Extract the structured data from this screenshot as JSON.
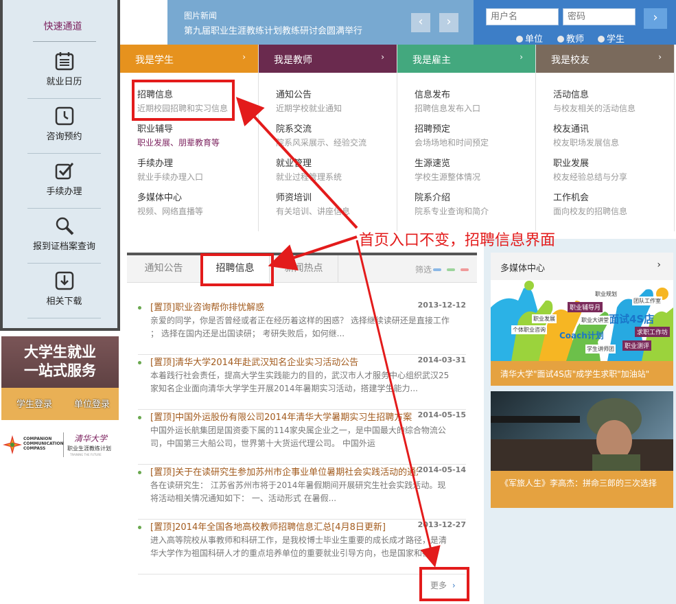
{
  "sidebar": {
    "title": "快速通道",
    "items": [
      {
        "label": "就业日历",
        "icon": "calendar-icon"
      },
      {
        "label": "咨询预约",
        "icon": "clock-icon"
      },
      {
        "label": "手续办理",
        "icon": "checkbox-icon"
      },
      {
        "label": "报到证档案查询",
        "icon": "magnifier-icon"
      },
      {
        "label": "相关下载",
        "icon": "download-icon"
      }
    ]
  },
  "promo": {
    "title_line1": "大学生就业",
    "title_line2": "一站式服务",
    "student_login": "学生登录",
    "employer_login": "单位登录"
  },
  "logos": {
    "ccc_line1": "COMPANION",
    "ccc_line2": "COMMUNICATION",
    "ccc_line3": "COMPASS",
    "tsinghua": "清华大学",
    "program": "职业生涯教练计划",
    "program_en": "TRAINING THE FUTURE"
  },
  "top_news": {
    "label": "图片新闻",
    "text": "第九届职业生涯教练计划教练研讨会圆满举行",
    "prev": "‹",
    "next": "›"
  },
  "login": {
    "username_placeholder": "用户名",
    "password_placeholder": "密码",
    "go": "›",
    "roles": [
      "单位",
      "教师",
      "学生"
    ]
  },
  "menu": {
    "columns": [
      {
        "head": "我是学生",
        "color": "#e6921e",
        "entries": [
          {
            "title": "招聘信息",
            "desc": "近期校园招聘和实习信息"
          },
          {
            "title": "职业辅导",
            "desc": "职业发展、朋辈教育等"
          },
          {
            "title": "手续办理",
            "desc": "就业手续办理入口"
          },
          {
            "title": "多媒体中心",
            "desc": "视频、网络直播等"
          }
        ]
      },
      {
        "head": "我是教师",
        "color": "#6a2a4e",
        "entries": [
          {
            "title": "通知公告",
            "desc": "近期学校就业通知"
          },
          {
            "title": "院系交流",
            "desc": "院系风采展示、经验交流"
          },
          {
            "title": "就业管理",
            "desc": "就业过程管理系统"
          },
          {
            "title": "师资培训",
            "desc": "有关培训、讲座信息"
          }
        ]
      },
      {
        "head": "我是雇主",
        "color": "#43a87e",
        "entries": [
          {
            "title": "信息发布",
            "desc": "招聘信息发布入口"
          },
          {
            "title": "招聘预定",
            "desc": "会场场地和时间预定"
          },
          {
            "title": "生源速览",
            "desc": "学校生源整体情况"
          },
          {
            "title": "院系介绍",
            "desc": "院系专业查询和简介"
          }
        ]
      },
      {
        "head": "我是校友",
        "color": "#7a6a5c",
        "entries": [
          {
            "title": "活动信息",
            "desc": "与校友相关的活动信息"
          },
          {
            "title": "校友通讯",
            "desc": "校友职场发展信息"
          },
          {
            "title": "职业发展",
            "desc": "校友经验总结与分享"
          },
          {
            "title": "工作机会",
            "desc": "面向校友的招聘信息"
          }
        ]
      }
    ],
    "chevron": "›"
  },
  "tabs": {
    "items": [
      "通知公告",
      "招聘信息",
      "新闻热点"
    ],
    "active": "招聘信息",
    "filter_label": "筛选",
    "filter_colors": [
      "#8bb8e6",
      "#9cd49c",
      "#f09a9a"
    ]
  },
  "news": [
    {
      "title": "[置顶]职业咨询帮你排忧解惑",
      "date": "2013-12-12",
      "summary": "亲爱的同学，你是否曾经或者正在经历着这样的困惑？ 选择继续读研还是直接工作 ； 选择在国内还是出国读研； 考研失败后，如何继..."
    },
    {
      "title": "[置顶]清华大学2014年赴武汉知名企业实习活动公告",
      "date": "2014-03-31",
      "summary": "本着践行社会责任，提高大学生实践能力的目的，武汉市人才服务中心组织武汉25家知名企业面向清华大学学生开展2014年暑期实习活动，搭建学生能力..."
    },
    {
      "title": "[置顶]中国外运股份有限公司2014年清华大学暑期实习生招聘方案",
      "date": "2014-05-15",
      "summary": "中国外运长航集团是国资委下属的114家央属企业之一，是中国最大的综合物流公司，中国第三大船公司，世界第十大货运代理公司。 中国外运"
    },
    {
      "title": "[置顶]关于在读研究生参加苏州市企事业单位暑期社会实践活动的通知",
      "date": "2014-05-14",
      "summary": "各在读研究生： 江苏省苏州市将于2014年暑假期间开展研究生社会实践活动。现将活动相关情况通知如下： 一、活动形式 在暑假..."
    },
    {
      "title": "[置顶]2014年全国各地高校教师招聘信息汇总[4月8日更新]",
      "date": "2013-12-27",
      "summary": "进入高等院校从事教师和科研工作，是我校博士毕业生重要的成长成才路径，是清华大学作为祖国科研人才的重点培养单位的重要就业引导方向，也是国家和社..."
    }
  ],
  "more_label": "更多",
  "more_chevron": "›",
  "media": {
    "title": "多媒体中心",
    "chevron": "›",
    "poster_big": "面试4S店",
    "poster_coach": "Coach计划",
    "poster_tags": [
      "职业辅导月",
      "个体职业咨询",
      "求职工作坊",
      "职业测评",
      "职业大讲堂",
      "学生讲师团",
      "职业规划",
      "团队工作室",
      "职业发展"
    ],
    "item1_caption": "清华大学\"面试4S店\"成学生求职\"加油站\"",
    "item2_caption": "《军旅人生》李高杰：拼命三郎的三次选择"
  },
  "annotation": {
    "text": "首页入口不变，招聘信息界面",
    "color": "#e31b1b"
  }
}
